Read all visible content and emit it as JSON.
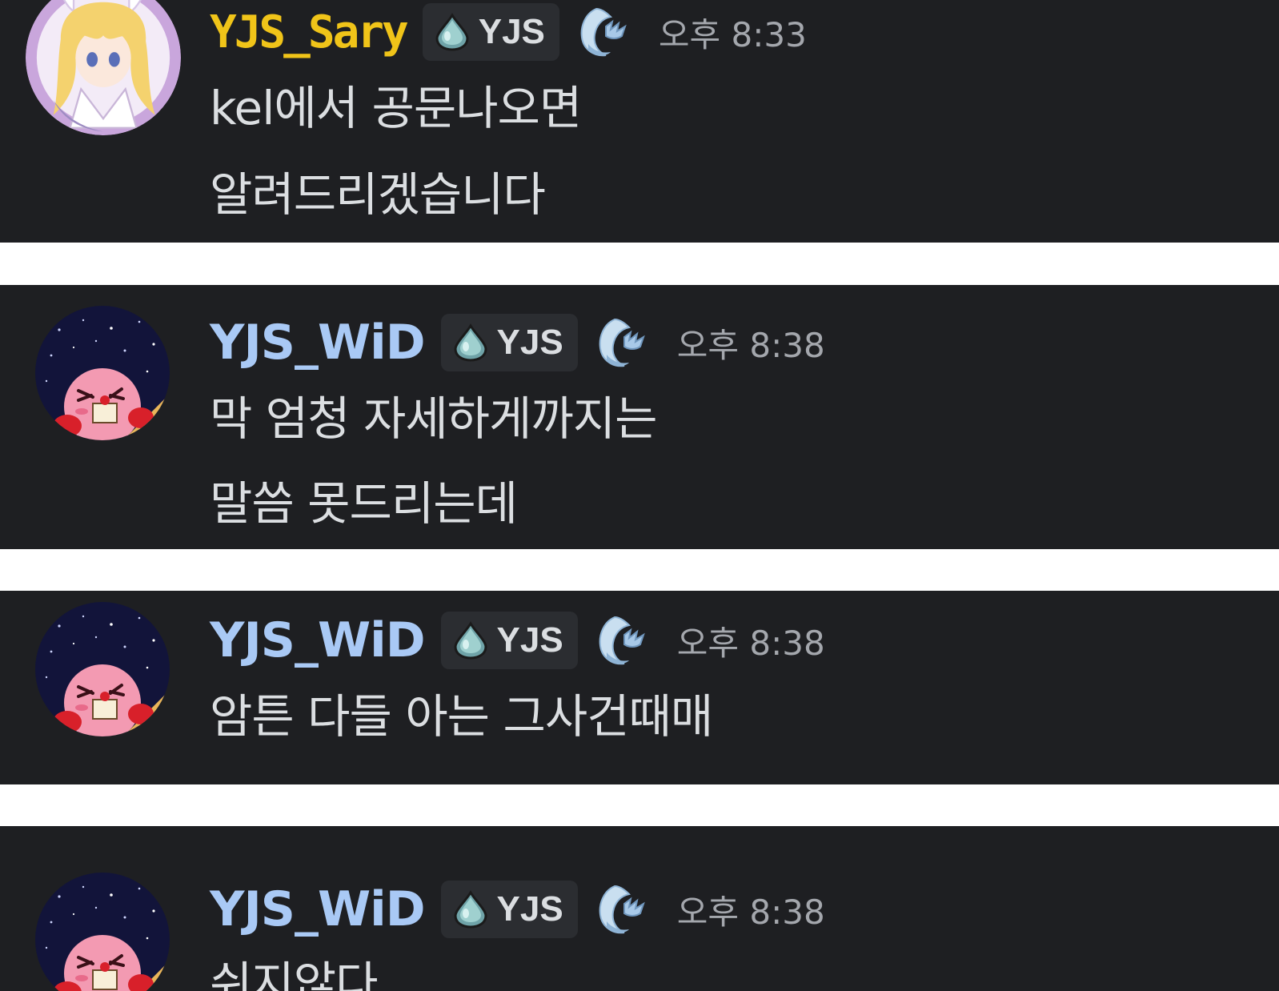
{
  "colors": {
    "background": "#1e1f22",
    "separator": "#ffffff",
    "sary_name": "#f0c419",
    "wid_name": "#a9c9f5",
    "tag_bg": "#2b2d31",
    "message_text": "#dbdee1",
    "timestamp": "#a4a7ad"
  },
  "messages": [
    {
      "username": "YJS_Sary",
      "tag": "YJS",
      "tag_icon": "water-drop-icon",
      "role_icon": "wave-icon",
      "time": "오후 8:33",
      "lines": [
        "kel에서 공문나오면",
        "알려드리겠습니다"
      ]
    },
    {
      "username": "YJS_WiD",
      "tag": "YJS",
      "tag_icon": "water-drop-icon",
      "role_icon": "wave-icon",
      "time": "오후 8:38",
      "lines": [
        "막 엄청 자세하게까지는",
        "말씀 못드리는데"
      ]
    },
    {
      "username": "YJS_WiD",
      "tag": "YJS",
      "tag_icon": "water-drop-icon",
      "role_icon": "wave-icon",
      "time": "오후 8:38",
      "lines": [
        "암튼 다들 아는 그사건때매"
      ]
    },
    {
      "username": "YJS_WiD",
      "tag": "YJS",
      "tag_icon": "water-drop-icon",
      "role_icon": "wave-icon",
      "time": "오후 8:38",
      "lines": [
        "쉬지않다"
      ]
    }
  ]
}
